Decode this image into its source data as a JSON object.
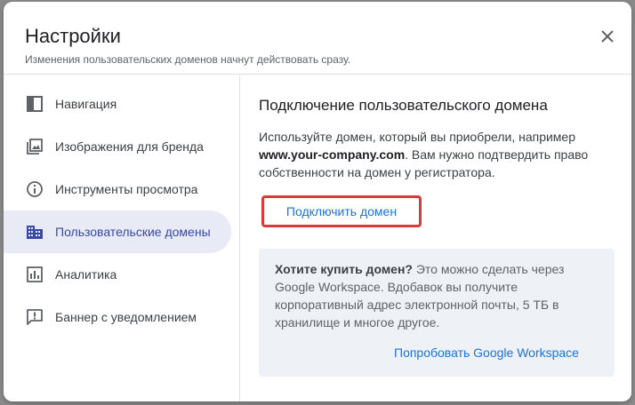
{
  "dialog": {
    "title": "Настройки",
    "subtitle": "Изменения пользовательских доменов начнут действовать сразу."
  },
  "sidebar": {
    "items": [
      {
        "label": "Навигация",
        "icon": "navigation-panel-icon"
      },
      {
        "label": "Изображения для бренда",
        "icon": "image-gallery-icon"
      },
      {
        "label": "Инструменты просмотра",
        "icon": "info-icon"
      },
      {
        "label": "Пользовательские домены",
        "icon": "domain-building-icon",
        "active": true
      },
      {
        "label": "Аналитика",
        "icon": "analytics-icon"
      },
      {
        "label": "Баннер с уведомлением",
        "icon": "announcement-icon"
      }
    ]
  },
  "main": {
    "title": "Подключение пользовательского домена",
    "desc_part1": "Используйте домен, который вы приобрели, например",
    "desc_domain": "www.your-company.com",
    "desc_part2": ". Вам нужно подтвердить право собственности на домен у регистратора.",
    "connect_button": "Подключить домен",
    "promo": {
      "bold": "Хотите купить домен?",
      "text": " Это можно сделать через Google Workspace. Вдобавок вы получите корпоративный адрес электронной почты, 5 ТБ в хранилище и многое другое.",
      "link": "Попробовать Google Workspace"
    }
  },
  "colors": {
    "accent": "#1a73e8",
    "active_bg": "#e8eaf6",
    "active_text": "#3949ab",
    "highlight_border": "#d93a3a",
    "promo_bg": "#eef1f5"
  }
}
